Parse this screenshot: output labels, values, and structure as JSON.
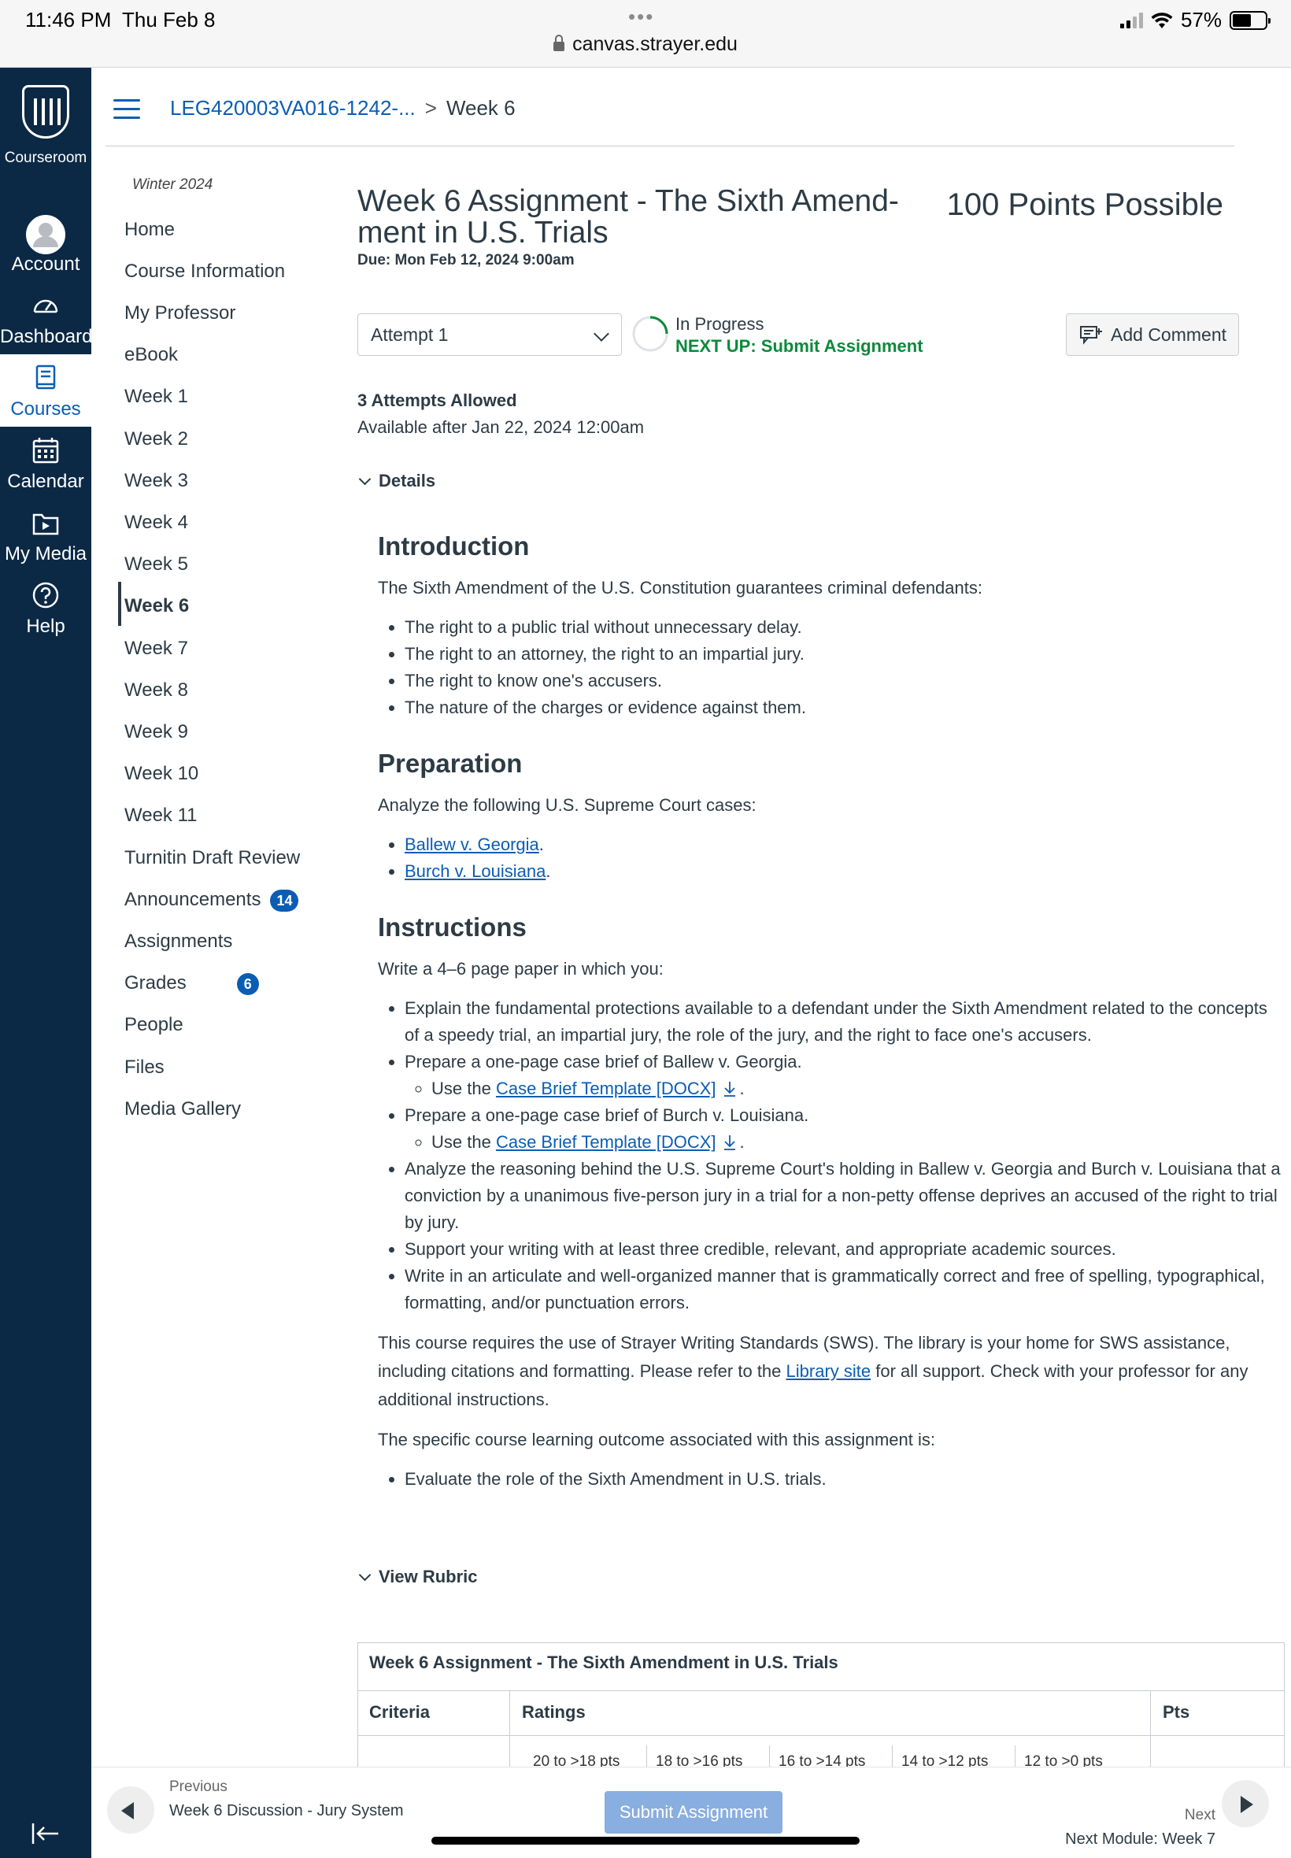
{
  "status_bar": {
    "time": "11:46 PM",
    "date": "Thu Feb 8",
    "url": "canvas.strayer.edu",
    "battery": "57%",
    "battery_level": 0.57
  },
  "global_nav": {
    "logo_label": "Courseroom",
    "items": [
      {
        "label": "Account",
        "icon": "account-icon"
      },
      {
        "label": "Dashboard",
        "icon": "dashboard-icon"
      },
      {
        "label": "Courses",
        "icon": "courses-icon"
      },
      {
        "label": "Calendar",
        "icon": "calendar-icon"
      },
      {
        "label": "My Media",
        "icon": "my-media-icon"
      },
      {
        "label": "Help",
        "icon": "help-icon"
      }
    ],
    "active": "Courses"
  },
  "breadcrumb": {
    "course": "LEG420003VA016-1242-...",
    "current": "Week 6"
  },
  "course_nav": {
    "term": "Winter 2024",
    "items": [
      {
        "label": "Home"
      },
      {
        "label": "Course Information"
      },
      {
        "label": "My Professor"
      },
      {
        "label": "eBook"
      },
      {
        "label": "Week 1"
      },
      {
        "label": "Week 2"
      },
      {
        "label": "Week 3"
      },
      {
        "label": "Week 4"
      },
      {
        "label": "Week 5"
      },
      {
        "label": "Week 6"
      },
      {
        "label": "Week 7"
      },
      {
        "label": "Week 8"
      },
      {
        "label": "Week 9"
      },
      {
        "label": "Week 10"
      },
      {
        "label": "Week 11"
      },
      {
        "label": "Turnitin Draft Review"
      },
      {
        "label": "Announcements",
        "badge": "14"
      },
      {
        "label": "Assignments"
      },
      {
        "label": "Grades",
        "badge": "6"
      },
      {
        "label": "People"
      },
      {
        "label": "Files"
      },
      {
        "label": "Media Gallery"
      }
    ],
    "active": "Week 6"
  },
  "assignment": {
    "title": "Week 6 Assignment - The Sixth Amend-ment in U.S. Trials",
    "points": "100 Points Possible",
    "due": "Due: Mon Feb 12, 2024 9:00am",
    "attempt_select": "Attempt 1",
    "status": "In Progress",
    "next_up": "NEXT UP: Submit Assignment",
    "add_comment": "Add Comment",
    "attempts_allowed": "3 Attempts Allowed",
    "available": "Available after Jan 22, 2024 12:00am",
    "details_toggle": "Details",
    "view_rubric_toggle": "View Rubric"
  },
  "content": {
    "introduction": {
      "heading": "Introduction",
      "text": "The Sixth Amendment of the U.S. Constitution guarantees criminal defendants:",
      "items": [
        "The right to a public trial without unnecessary delay.",
        "The right to an attorney, the right to an impartial jury.",
        "The right to know one's accusers.",
        "The nature of the charges or evidence against them."
      ]
    },
    "preparation": {
      "heading": "Preparation",
      "text": "Analyze the following U.S. Supreme Court cases:",
      "links": [
        "Ballew v. Georgia",
        "Burch v. Louisiana"
      ]
    },
    "instructions": {
      "heading": "Instructions",
      "text": "Write a 4–6 page paper in which you:",
      "item1": "Explain the fundamental protections available to a defendant under the Sixth Amendment related to the concepts of a speedy trial, an impartial jury, the role of the jury, and the right to face one's accusers.",
      "item2": "Prepare a one-page case brief of Ballew v. Georgia.",
      "use_the": "Use the",
      "template_link": "Case Brief Template [DOCX]",
      "item3": "Prepare a one-page case brief of Burch v. Louisiana.",
      "item4": "Analyze the reasoning behind the U.S. Supreme Court's holding in Ballew v. Georgia and Burch v. Louisiana that a conviction by a unanimous five-person jury in a trial for a non-petty offense deprives an accused of the right to trial by jury.",
      "item5": "Support your writing with at least three credible, relevant, and appropriate academic sources.",
      "item6": "Write in an articulate and well-organized manner that is grammatically correct and free of spelling, typographical, formatting, and/or punctuation errors.",
      "sws_before": "This course requires the use of Strayer Writing Standards (SWS). The library is your home for SWS assistance, including citations and formatting. Please refer to the",
      "library_link": "Library site",
      "sws_after": "for all support. Check with your professor for any additional instructions.",
      "outcome_intro": "The specific course learning outcome associated with this assignment is:",
      "outcome": "Evaluate the role of the Sixth Amendment in U.S. trials."
    }
  },
  "rubric": {
    "title": "Week 6 Assignment - The Sixth Amendment in U.S. Trials",
    "col_criteria": "Criteria",
    "col_ratings": "Ratings",
    "col_pts": "Pts",
    "ratings": [
      "20 to >18 pts",
      "18 to >16 pts",
      "16 to >14 pts",
      "14 to >12 pts",
      "12 to >0 pts"
    ]
  },
  "footer": {
    "previous_label": "Previous",
    "previous_name": "Week 6 Discussion - Jury System",
    "submit": "Submit Assignment",
    "next_label": "Next",
    "next_name": "Next Module: Week 7"
  },
  "colors": {
    "nav_bg": "#0b2945",
    "link": "#0b5db3",
    "next_up": "#0b8a3c",
    "submit_bg": "#89aee0"
  }
}
